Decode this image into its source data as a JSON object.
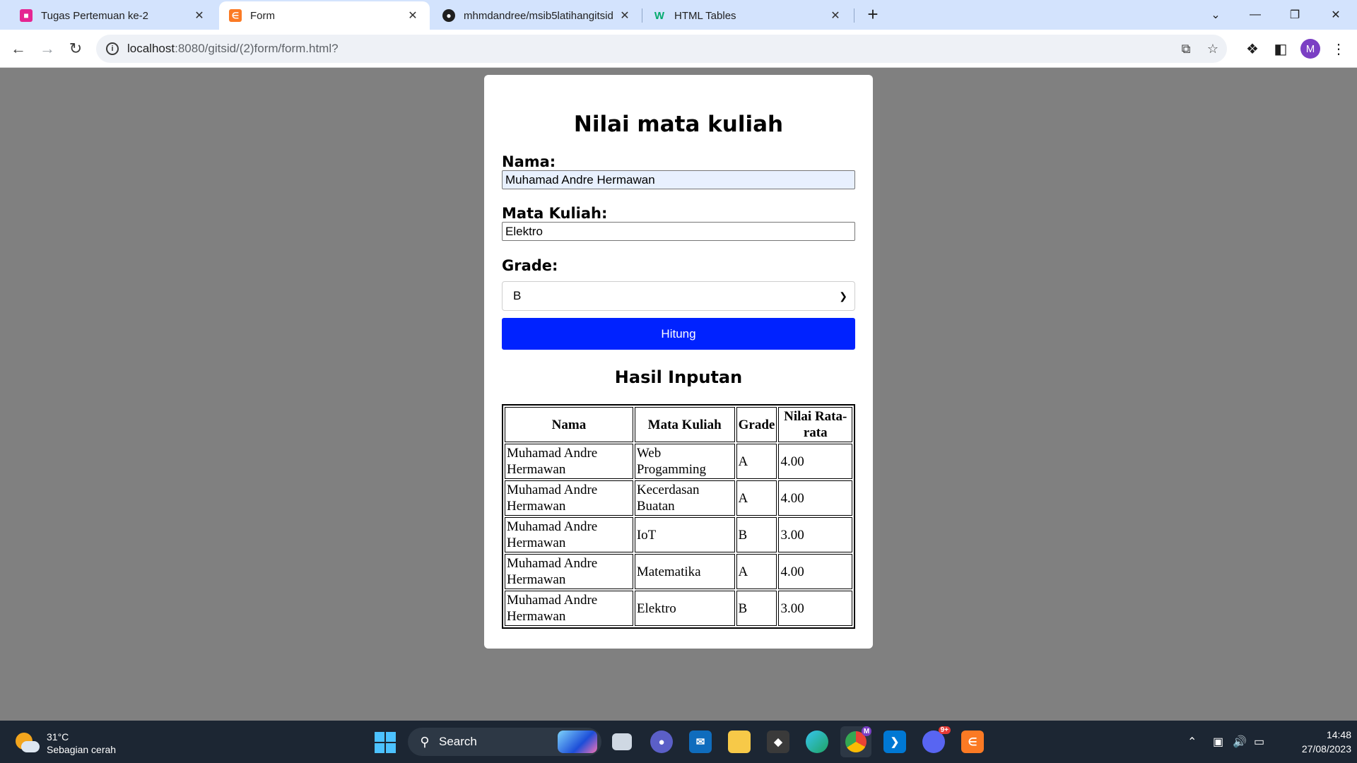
{
  "browser": {
    "tabs": [
      {
        "title": "Tugas Pertemuan ke-2",
        "favicon": "classroom-icon",
        "color": "#e52592",
        "active": false
      },
      {
        "title": "Form",
        "favicon": "xampp-icon",
        "color": "#fb7a24",
        "active": true
      },
      {
        "title": "mhmdandree/msib5latihangitsid",
        "favicon": "github-icon",
        "color": "#000000",
        "active": false
      },
      {
        "title": "HTML Tables",
        "favicon": "w3schools-icon",
        "color": "#04aa6d",
        "active": false
      }
    ],
    "url_host": "localhost",
    "url_path": ":8080/gitsid/(2)form/form.html?",
    "profile_initial": "M"
  },
  "form": {
    "title": "Nilai mata kuliah",
    "nama_label": "Nama:",
    "nama_value": "Muhamad Andre Hermawan",
    "matkul_label": "Mata Kuliah:",
    "matkul_value": "Elektro",
    "grade_label": "Grade:",
    "grade_value": "B",
    "submit_label": "Hitung",
    "accent_color": "#0022ff"
  },
  "results": {
    "title": "Hasil Inputan",
    "headers": [
      "Nama",
      "Mata Kuliah",
      "Grade",
      "Nilai Rata-rata"
    ],
    "rows": [
      [
        "Muhamad Andre Hermawan",
        "Web Progamming",
        "A",
        "4.00"
      ],
      [
        "Muhamad Andre Hermawan",
        "Kecerdasan Buatan",
        "A",
        "4.00"
      ],
      [
        "Muhamad Andre Hermawan",
        "IoT",
        "B",
        "3.00"
      ],
      [
        "Muhamad Andre Hermawan",
        "Matematika",
        "A",
        "4.00"
      ],
      [
        "Muhamad Andre Hermawan",
        "Elektro",
        "B",
        "3.00"
      ]
    ]
  },
  "taskbar": {
    "weather_temp": "31°C",
    "weather_desc": "Sebagian cerah",
    "search_label": "Search",
    "time": "14:48",
    "date": "27/08/2023",
    "discord_badge": "9+",
    "chrome_badge": "M"
  }
}
